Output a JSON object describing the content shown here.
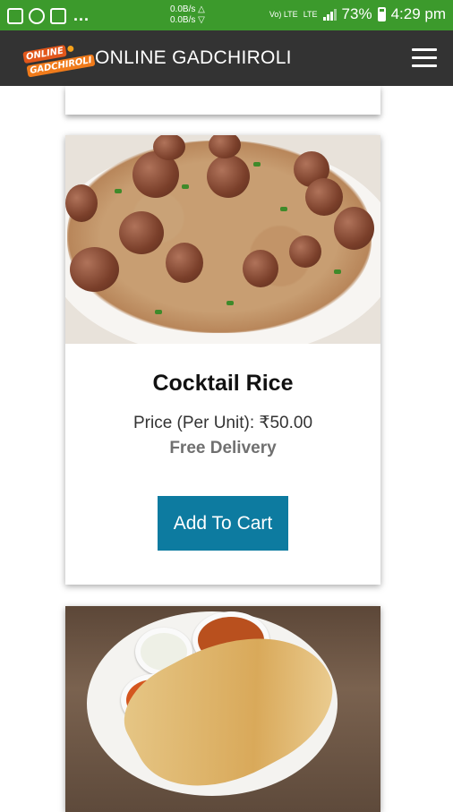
{
  "status_bar": {
    "net_speed_up": "0.0B/s △",
    "net_speed_down": "0.0B/s ▽",
    "volte_label": "Vo) LTE",
    "lte_label": "LTE",
    "battery": "73%",
    "time": "4:29 pm",
    "more_indicator": "..."
  },
  "app_bar": {
    "logo_text_line1": "ONLINE",
    "logo_text_line2": "GADCHIROLI",
    "title": "ONLINE GADCHIROLI",
    "menu_icon": "hamburger-menu-icon"
  },
  "products": [
    {
      "name": "Cocktail Rice",
      "price_label": "Price (Per Unit): ₹50.00",
      "delivery": "Free Delivery",
      "button": "Add To Cart",
      "image": "cocktail-rice-photo"
    },
    {
      "image": "masala-dosa-photo"
    }
  ],
  "colors": {
    "status_bar": "#3c9a2c",
    "app_bar": "#333333",
    "button": "#0d7ba0",
    "delivery_text": "#707070"
  }
}
